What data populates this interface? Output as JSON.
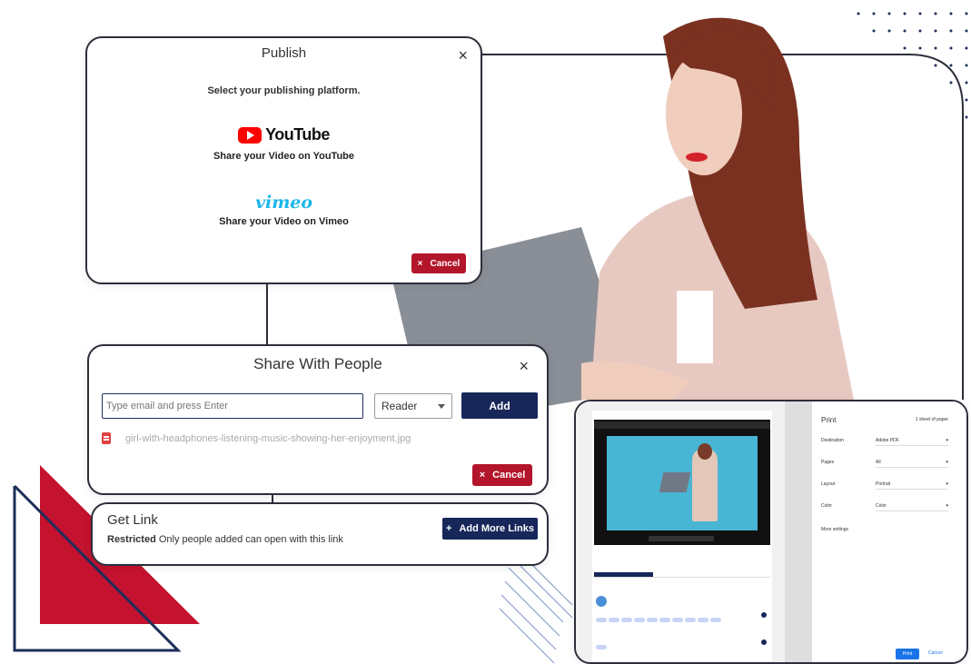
{
  "publish": {
    "title": "Publish",
    "close": "×",
    "subtitle": "Select your publishing platform.",
    "youtube_logo": "YouTube",
    "youtube_text": "Share your Video on YouTube",
    "vimeo_logo": "vimeo",
    "vimeo_text": "Share your Video on Vimeo",
    "cancel_label": "Cancel",
    "cancel_icon": "×"
  },
  "share": {
    "title": "Share With People",
    "close": "×",
    "email_placeholder": "Type email and press Enter",
    "role": "Reader",
    "add_label": "Add",
    "file_name": "girl-with-headphones-listening-music-showing-her-enjoyment.jpg",
    "cancel_label": "Cancel",
    "cancel_icon": "×"
  },
  "get_link": {
    "title": "Get Link",
    "restricted_label": "Restricted",
    "restricted_desc": " Only people added can open with this link",
    "more_icon": "+",
    "more_label": "Add More Links"
  },
  "print_preview": {
    "title": "Print",
    "sheets": "1 sheet of paper",
    "rows": [
      {
        "label": "Destination",
        "value": "Adobe PDF"
      },
      {
        "label": "Pages",
        "value": "All"
      },
      {
        "label": "Layout",
        "value": "Portrait"
      },
      {
        "label": "Color",
        "value": "Color"
      }
    ],
    "more_settings": "More settings",
    "print_label": "Print",
    "cancel_label": "Cancel"
  },
  "colors": {
    "navy": "#17275a",
    "red": "#b3152a",
    "youtube_red": "#ff0000",
    "vimeo_blue": "#1ab7ea",
    "deco_red": "#c4122f"
  }
}
